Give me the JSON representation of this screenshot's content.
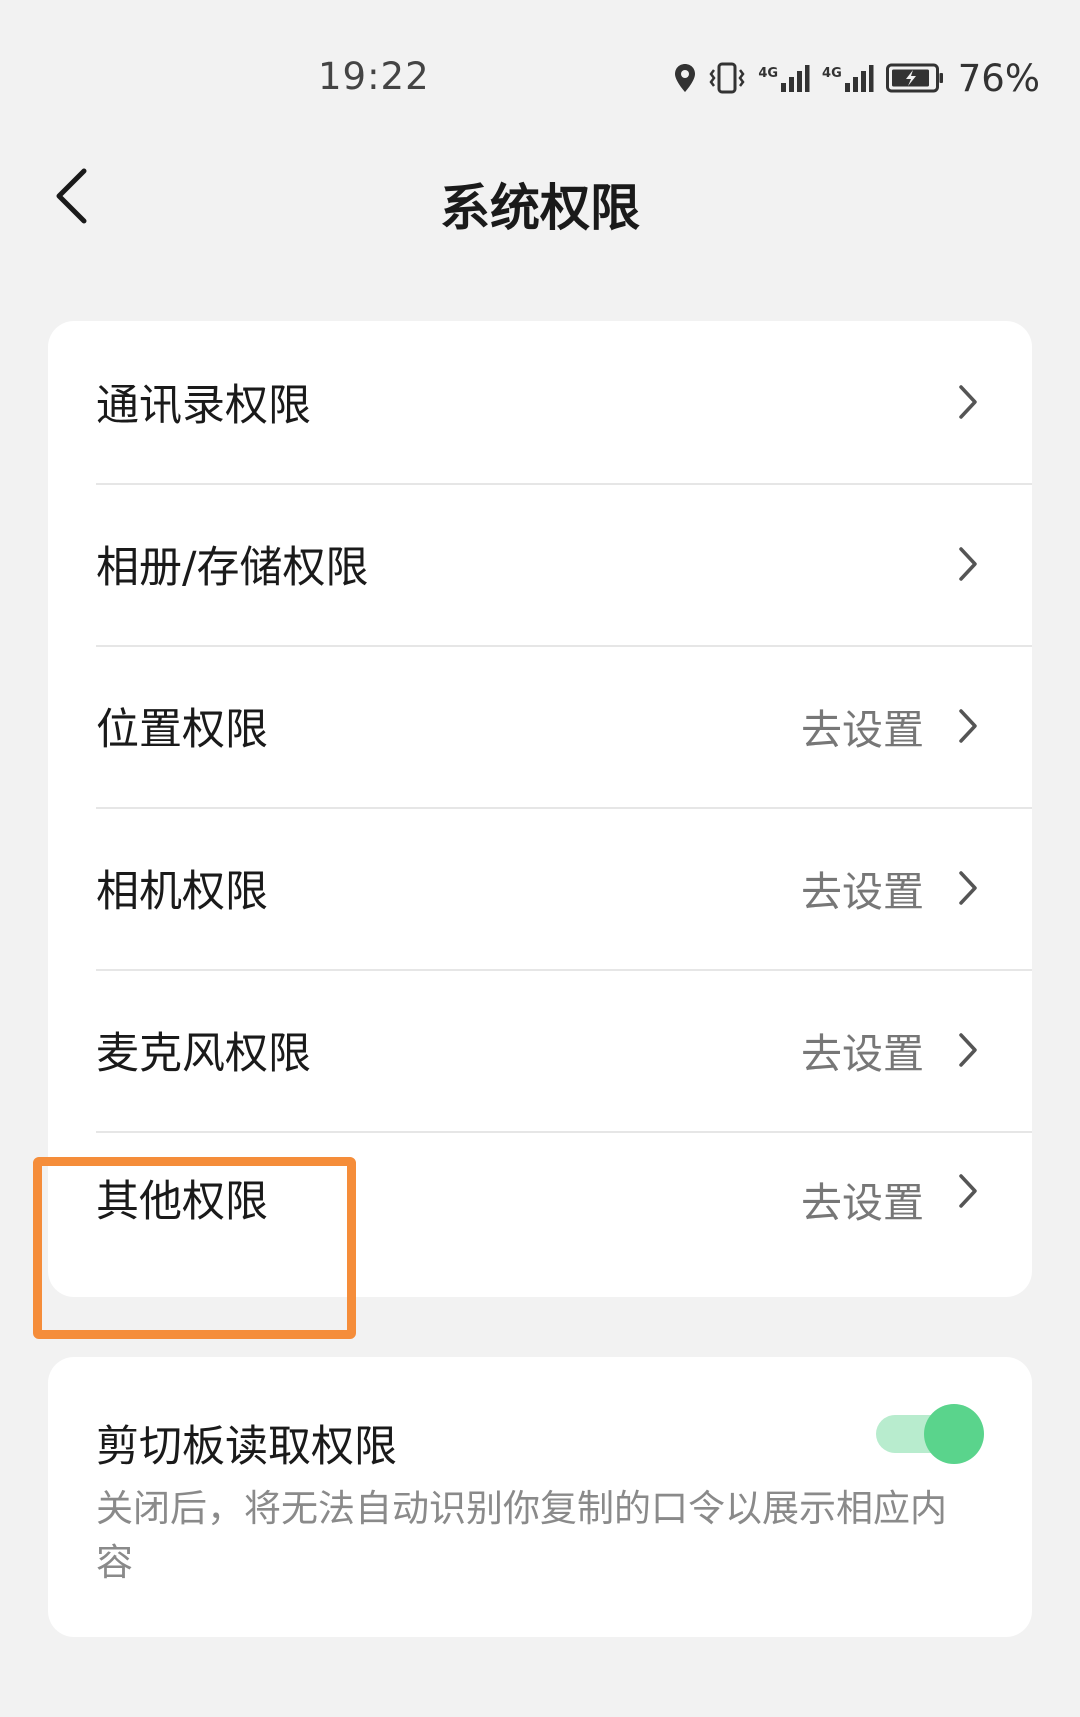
{
  "status_bar": {
    "time": "19:22",
    "network_1": "4G",
    "network_2": "4G",
    "battery_percent": "76%"
  },
  "header": {
    "title": "系统权限"
  },
  "permissions": {
    "items": [
      {
        "label": "通讯录权限",
        "action": ""
      },
      {
        "label": "相册/存储权限",
        "action": ""
      },
      {
        "label": "位置权限",
        "action": "去设置"
      },
      {
        "label": "相机权限",
        "action": "去设置"
      },
      {
        "label": "麦克风权限",
        "action": "去设置"
      },
      {
        "label": "其他权限",
        "action": "去设置"
      }
    ]
  },
  "clipboard": {
    "title": "剪切板读取权限",
    "description": "关闭后，将无法自动识别你复制的口令以展示相应内容",
    "enabled": true
  },
  "colors": {
    "highlight": "#f58d3a",
    "toggle_on": "#5ad48c"
  }
}
